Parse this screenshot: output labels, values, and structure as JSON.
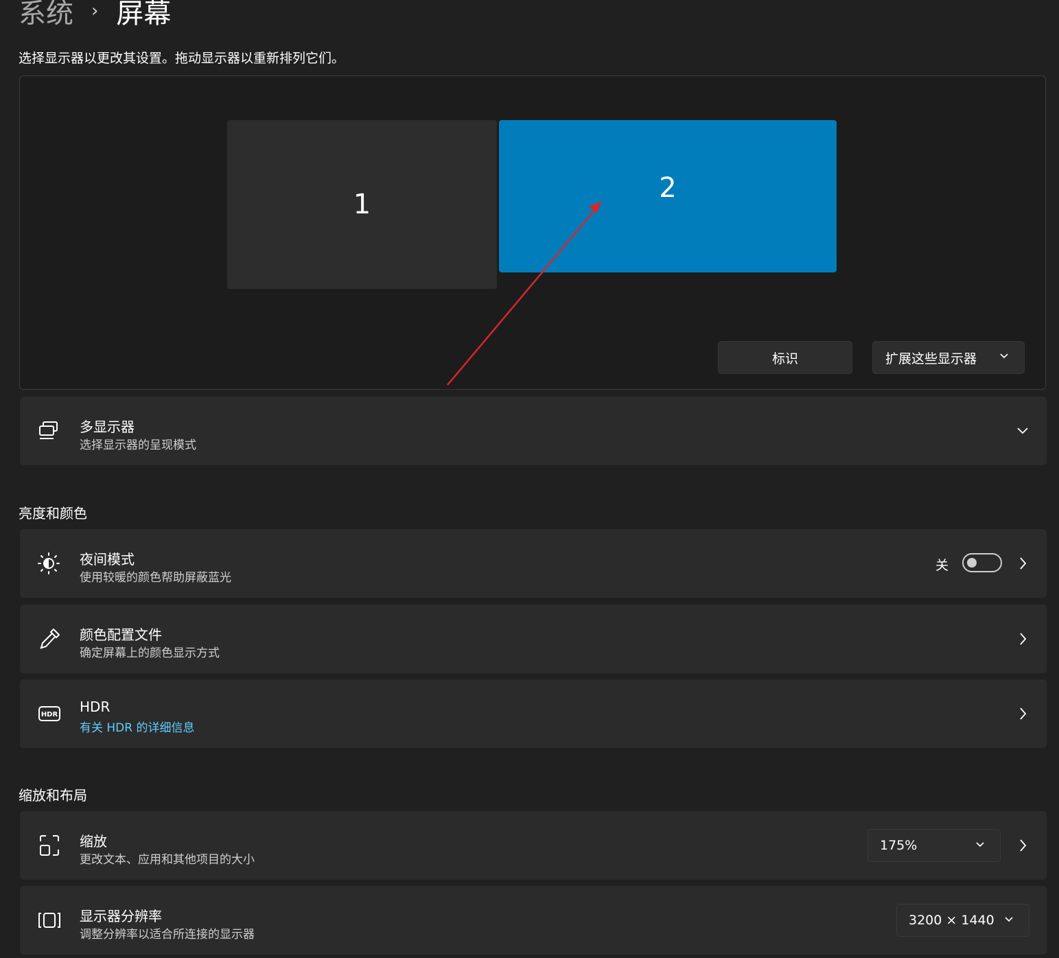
{
  "breadcrumb": {
    "parent": "系统",
    "separator": "›",
    "current": "屏幕"
  },
  "instructions": "选择显示器以更改其设置。拖动显示器以重新排列它们。",
  "arrangement": {
    "monitors": [
      {
        "label": "1",
        "selected": false
      },
      {
        "label": "2",
        "selected": true
      }
    ],
    "identify_button": "标识",
    "multi_display_dropdown": "扩展这些显示器"
  },
  "multiple_displays": {
    "title": "多显示器",
    "subtitle": "选择显示器的呈现模式",
    "icon": "multi-monitor-icon"
  },
  "section_brightness": "亮度和颜色",
  "night_light": {
    "title": "夜间模式",
    "subtitle": "使用较暖的颜色帮助屏蔽蓝光",
    "toggle_label": "关",
    "toggle_on": false,
    "icon": "brightness-icon"
  },
  "color_profile": {
    "title": "颜色配置文件",
    "subtitle": "确定屏幕上的颜色显示方式",
    "icon": "eyedropper-icon"
  },
  "hdr": {
    "title": "HDR",
    "link": "有关 HDR 的详细信息",
    "icon": "hdr-icon"
  },
  "section_scale_layout": "缩放和布局",
  "scale": {
    "title": "缩放",
    "subtitle": "更改文本、应用和其他项目的大小",
    "value": "175%",
    "icon": "scale-icon"
  },
  "resolution": {
    "title": "显示器分辨率",
    "subtitle": "调整分辨率以适合所连接的显示器",
    "value": "3200 × 1440",
    "icon": "resolution-icon"
  },
  "colors": {
    "background": "#202020",
    "card": "#2b2b2b",
    "accent": "#017dbb",
    "link": "#60cdff",
    "annotation_arrow": "#d7262e"
  }
}
